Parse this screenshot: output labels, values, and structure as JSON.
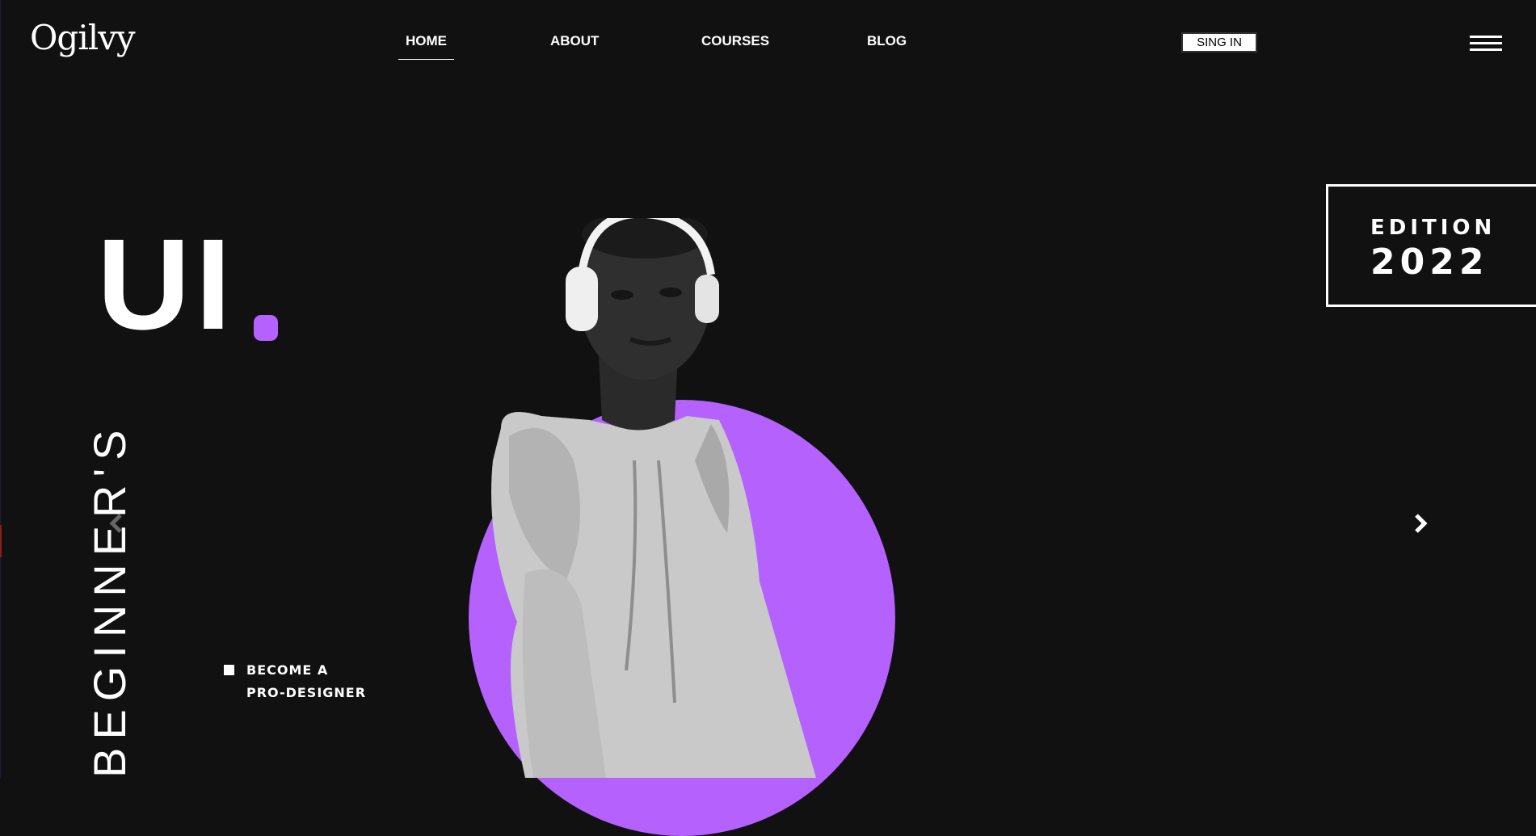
{
  "brand": {
    "logo_text": "Ogilvy"
  },
  "nav": {
    "items": [
      {
        "label": "HOME",
        "active": true
      },
      {
        "label": "ABOUT",
        "active": false
      },
      {
        "label": "COURSES",
        "active": false
      },
      {
        "label": "BLOG",
        "active": false
      }
    ]
  },
  "header": {
    "signin_label": "SING IN",
    "menu_icon": "hamburger-menu-icon"
  },
  "hero": {
    "title": "UI",
    "vertical_text": "BEGINNER'S",
    "tagline_line1": "BECOME A",
    "tagline_line2": "PRO-DESIGNER",
    "accent_color": "#b561fd"
  },
  "edition": {
    "label": "EDITION",
    "year": "2022"
  },
  "carousel": {
    "next_icon": "chevron-right-icon",
    "prev_icon": "chevron-left-icon"
  }
}
